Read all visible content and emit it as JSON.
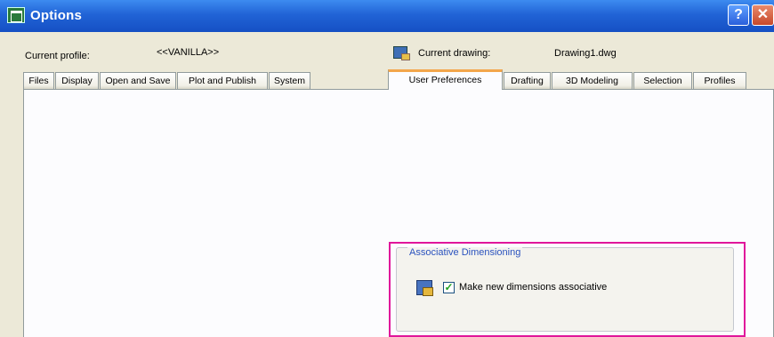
{
  "window": {
    "title": "Options"
  },
  "titlebar": {
    "help_label": "?",
    "close_label": "✕"
  },
  "profile": {
    "current_profile_label": "Current profile:",
    "current_profile_value": "<<VANILLA>>",
    "current_drawing_label": "Current drawing:",
    "current_drawing_value": "Drawing1.dwg"
  },
  "tabs": [
    {
      "label": "Files"
    },
    {
      "label": "Display"
    },
    {
      "label": "Open and Save"
    },
    {
      "label": "Plot and Publish"
    },
    {
      "label": "System"
    },
    {
      "label": "User Preferences",
      "active": true
    },
    {
      "label": "Drafting"
    },
    {
      "label": "3D Modeling"
    },
    {
      "label": "Selection"
    },
    {
      "label": "Profiles"
    }
  ],
  "associative_dimensioning": {
    "group_title": "Associative Dimensioning",
    "checkbox_label": "Make new dimensions associative",
    "checked": true,
    "check_glyph": "✓"
  },
  "colors": {
    "titlebar": "#2163d6",
    "active_tab_accent": "#f3a64b",
    "group_title": "#2a52be",
    "highlight_border": "#e0169b"
  }
}
